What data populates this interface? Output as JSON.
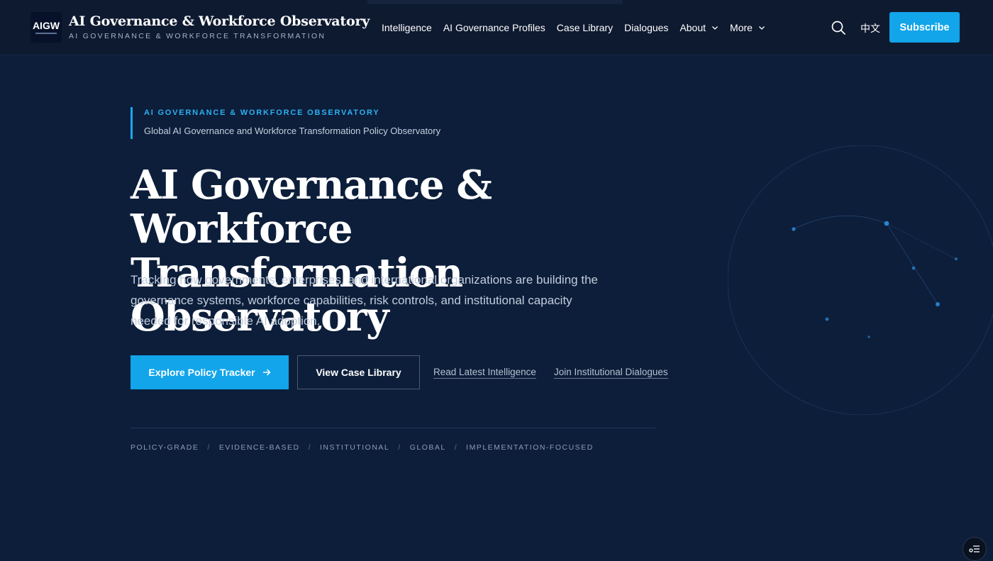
{
  "header": {
    "logo_text": "AIGW",
    "brand_title": "AI Governance & Workforce Observatory",
    "brand_subtitle": "AI GOVERNANCE & WORKFORCE TRANSFORMATION",
    "nav": [
      {
        "label": "Intelligence",
        "dropdown": false
      },
      {
        "label": "AI Governance Profiles",
        "dropdown": false
      },
      {
        "label": "Case Library",
        "dropdown": false
      },
      {
        "label": "Dialogues",
        "dropdown": false
      },
      {
        "label": "About",
        "dropdown": true
      },
      {
        "label": "More",
        "dropdown": true
      }
    ],
    "search_icon": "search-icon",
    "language_label": "中文",
    "subscribe_label": "Subscribe"
  },
  "hero": {
    "eyebrow": "AI GOVERNANCE & WORKFORCE OBSERVATORY",
    "eyebrow_sub": "Global AI Governance and Workforce Transformation Policy Observatory",
    "title_line1": "AI Governance & Workforce",
    "title_line2": "Transformation Observatory",
    "description": "Tracking how governments, enterprises, and international organizations are building the governance systems, workforce capabilities, risk controls, and institutional capacity needed for responsible AI adoption.",
    "primary_cta": "Explore Policy Tracker",
    "secondary_cta": "View Case Library",
    "link_intelligence": "Read Latest Intelligence",
    "link_dialogues": "Join Institutional Dialogues",
    "tags": [
      "POLICY-GRADE",
      "EVIDENCE-BASED",
      "INSTITUTIONAL",
      "GLOBAL",
      "IMPLEMENTATION-FOCUSED"
    ],
    "tag_separator": "/"
  },
  "colors": {
    "background": "#0c1e3a",
    "header": "#0e1a30",
    "accent": "#12a5ea",
    "eyebrow": "#2cb0f2"
  }
}
